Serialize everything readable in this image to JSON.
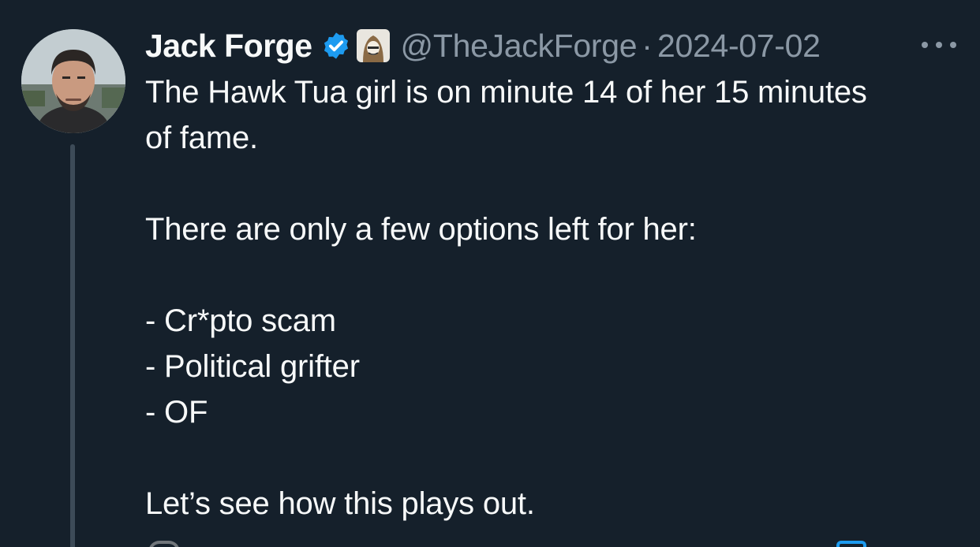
{
  "tweet": {
    "display_name": "Jack Forge",
    "handle": "@TheJackForge",
    "separator": "·",
    "date": "2024-07-02",
    "verified_color": "#1d9bf0",
    "lines": [
      "The Hawk Tua girl is on minute 14 of her 15 minutes",
      "of fame.",
      "",
      "There are only a few options left for her:",
      "",
      "- Cr*pto scam",
      "- Political grifter",
      "- OF",
      "",
      "Let’s see how this plays out."
    ]
  },
  "icons": {
    "verified": "verified-badge-icon",
    "affiliate": "affiliate-badge-icon",
    "more": "more-options-icon"
  },
  "colors": {
    "background": "#15202b",
    "text": "#f7f9f9",
    "secondary": "#8b98a5",
    "accent": "#1d9bf0"
  }
}
